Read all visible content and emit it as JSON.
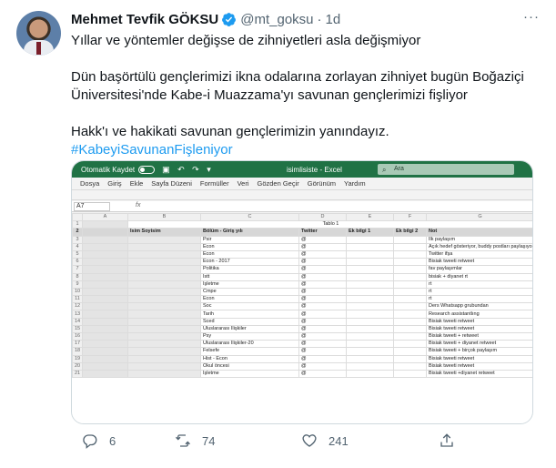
{
  "tweet": {
    "author_name": "Mehmet Tevfik GÖKSU",
    "handle": "@mt_goksu",
    "separator": "·",
    "time": "1d",
    "paragraphs": [
      "Yıllar ve yöntemler değişse de zihniyetleri asla değişmiyor",
      "Dün başörtülü gençlerimizi ikna odalarına zorlayan zihniyet bugün Boğaziçi Üniversitesi'nde Kabe-i Muazzama'yı savunan gençlerimizi fişliyor",
      "Hakk'ı ve hakikati savunan gençlerimizin yanındayız."
    ],
    "hashtag": "#KabeyiSavunanFişleniyor",
    "more_label": "···"
  },
  "excel": {
    "autosave_label": "Otomatik Kaydet",
    "doc_title": "isimlisiste - Excel",
    "search_placeholder": "Ara",
    "menu": [
      "Dosya",
      "Giriş",
      "Ekle",
      "Sayfa Düzeni",
      "Formüller",
      "Veri",
      "Gözden Geçir",
      "Görünüm",
      "Yardım"
    ],
    "name_box": "A7",
    "fx": "fx",
    "columns": [
      "A",
      "B",
      "C",
      "D",
      "E",
      "F",
      "G"
    ],
    "table_title": "Tablo 1",
    "headers": [
      "İsim Soyisim",
      "Bölüm - Giriş yılı",
      "Twitter",
      "Ek bilgi 1",
      "Ek bilgi 2",
      "Not"
    ],
    "rows": [
      {
        "bolum": "Psir",
        "twitter": "@",
        "not": "İlk paylaşım"
      },
      {
        "bolum": "Econ",
        "twitter": "@",
        "not": "Açık hedef gösteriyor, buddy postları paylaşıyor"
      },
      {
        "bolum": "Econ",
        "twitter": "@",
        "not": "Twitter ifşa"
      },
      {
        "bolum": "Econ - 2017",
        "twitter": "@",
        "not": "Bisiak tweeti retweet"
      },
      {
        "bolum": "Politika",
        "twitter": "@",
        "not": "fav paylaşımlar"
      },
      {
        "bolum": "Istt",
        "twitter": "@",
        "not": "bisiak + diyanet rt"
      },
      {
        "bolum": "İşletme",
        "twitter": "@",
        "not": "rt"
      },
      {
        "bolum": "Cmpe",
        "twitter": "@",
        "not": "rt"
      },
      {
        "bolum": "Econ",
        "twitter": "@",
        "not": "rt"
      },
      {
        "bolum": "Soc",
        "twitter": "@",
        "not": "Ders Whatsapp grubundan"
      },
      {
        "bolum": "Tarih",
        "twitter": "@",
        "not": "Research assistantlıng"
      },
      {
        "bolum": "Sced",
        "twitter": "@",
        "not": "Bisiak tweeti retweet"
      },
      {
        "bolum": "Uluslararası İlişkiler",
        "twitter": "@",
        "not": "Bisiak tweeti retweet"
      },
      {
        "bolum": "Psy",
        "twitter": "@",
        "not": "Bisiak tweeti + retweet"
      },
      {
        "bolum": "Uluslararası İlişkiler-20",
        "twitter": "@",
        "not": "Bisiak tweeti + diyanet retweet"
      },
      {
        "bolum": "Felsefe",
        "twitter": "@",
        "not": "Bisiak tweeti + birçok paylaşım"
      },
      {
        "bolum": "Hist - Econ",
        "twitter": "@",
        "not": "Bisiak tweeti retweet"
      },
      {
        "bolum": "Okul öncesi",
        "twitter": "@",
        "not": "Bisiak tweeti retweet"
      },
      {
        "bolum": "İşletme",
        "twitter": "@",
        "not": "Bisiak tweeti +diyanet retweet"
      }
    ]
  },
  "actions": {
    "replies": "6",
    "retweets": "74",
    "likes": "241"
  },
  "colors": {
    "excel_green": "#207245",
    "hashtag_blue": "#1d9bf0",
    "muted_text": "#536471"
  }
}
